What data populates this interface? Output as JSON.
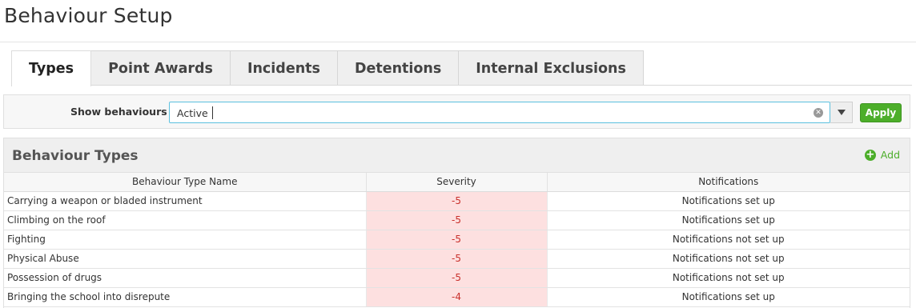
{
  "page": {
    "title": "Behaviour Setup"
  },
  "tabs": [
    {
      "label": "Types",
      "active": true
    },
    {
      "label": "Point Awards",
      "active": false
    },
    {
      "label": "Incidents",
      "active": false
    },
    {
      "label": "Detentions",
      "active": false
    },
    {
      "label": "Internal Exclusions",
      "active": false
    }
  ],
  "filter": {
    "label": "Show behaviours",
    "value": "Active",
    "clear_icon": "clear-icon",
    "dropdown_icon": "chevron-down-icon",
    "apply_label": "Apply"
  },
  "panel": {
    "title": "Behaviour Types",
    "add_label": "Add",
    "add_icon": "plus-circle-icon",
    "columns": [
      "Behaviour Type Name",
      "Severity",
      "Notifications"
    ],
    "rows": [
      {
        "name": "Carrying a weapon or bladed instrument",
        "severity": "-5",
        "notifications": "Notifications set up"
      },
      {
        "name": "Climbing on the roof",
        "severity": "-5",
        "notifications": "Notifications set up"
      },
      {
        "name": "Fighting",
        "severity": "-5",
        "notifications": "Notifications not set up"
      },
      {
        "name": "Physical Abuse",
        "severity": "-5",
        "notifications": "Notifications not set up"
      },
      {
        "name": "Possession of drugs",
        "severity": "-5",
        "notifications": "Notifications not set up"
      },
      {
        "name": "Bringing the school into disrepute",
        "severity": "-4",
        "notifications": "Notifications set up"
      }
    ]
  },
  "colors": {
    "accent_green": "#4cae2a",
    "severity_bg": "#fde0e0",
    "severity_text": "#c9302c",
    "focus_border": "#5bc0de"
  }
}
